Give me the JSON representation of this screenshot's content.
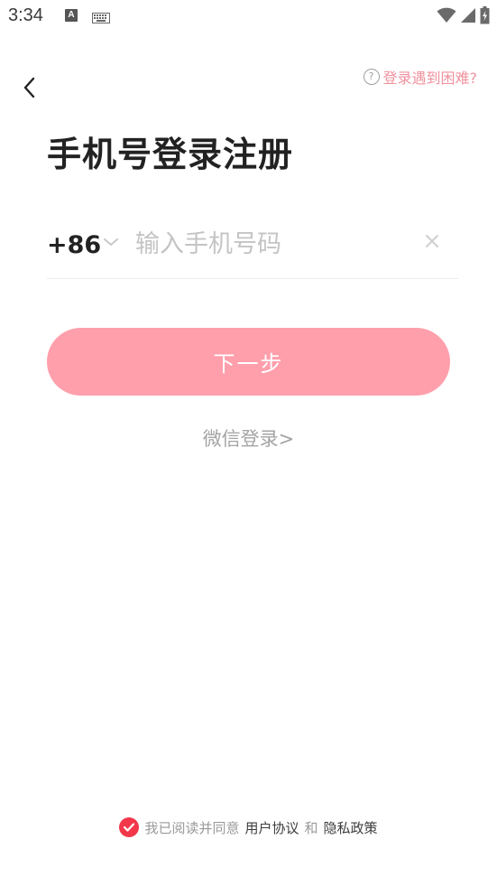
{
  "status_bar": {
    "time": "3:34",
    "a_icon_letter": "A"
  },
  "header": {
    "help_text": "登录遇到困难?",
    "help_icon_glyph": "?"
  },
  "title": "手机号登录注册",
  "phone": {
    "country_code": "+86",
    "placeholder": "输入手机号码",
    "value": ""
  },
  "next_button_label": "下一步",
  "wechat_login_label": "微信登录>",
  "agreement": {
    "prefix": "我已阅读并同意",
    "user_agreement": "用户协议",
    "and": "和",
    "privacy_policy": "隐私政策",
    "checked": true
  },
  "colors": {
    "accent_pink": "#ff9fac",
    "help_pink": "#f0929e",
    "check_red": "#f2374a"
  },
  "icons": [
    "back-chevron-icon",
    "help-circle-icon",
    "chevron-down-icon",
    "clear-icon",
    "check-icon",
    "wifi-icon",
    "signal-icon",
    "battery-icon",
    "keyboard-icon"
  ]
}
